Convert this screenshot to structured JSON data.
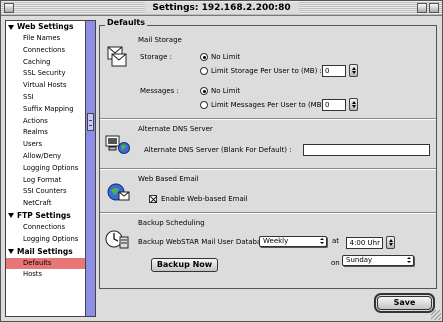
{
  "window": {
    "title": "Settings: 192.168.2.200:80"
  },
  "sidebar": {
    "groups": [
      {
        "label": "Web Settings",
        "items": [
          "File Names",
          "Connections",
          "Caching",
          "SSL Security",
          "Virtual Hosts",
          "SSI",
          "Suffix Mapping",
          "Actions",
          "Realms",
          "Users",
          "Allow/Deny",
          "Logging Options",
          "Log Format",
          "SSI Counters",
          "NetCraft"
        ]
      },
      {
        "label": "FTP Settings",
        "items": [
          "Connections",
          "Logging Options"
        ]
      },
      {
        "label": "Mail Settings",
        "items": [
          "Defaults",
          "Hosts"
        ]
      }
    ],
    "selected": "Defaults"
  },
  "main": {
    "group_title": "Defaults",
    "mail_storage": {
      "title": "Mail Storage",
      "storage_label": "Storage :",
      "storage_opt1": "No Limit",
      "storage_opt2": "Limit Storage Per User to (MB) :",
      "storage_value": "0",
      "messages_label": "Messages :",
      "messages_opt1": "No Limit",
      "messages_opt2": "Limit Messages Per User to (MB) :",
      "messages_value": "0"
    },
    "dns": {
      "title": "Alternate DNS Server",
      "field_label": "Alternate DNS Server (Blank For Default) :",
      "value": ""
    },
    "web_email": {
      "title": "Web Based Email",
      "checkbox_label": "Enable Web-based Email",
      "checked": true
    },
    "backup": {
      "title": "Backup Scheduling",
      "label": "Backup WebSTAR Mail User Database",
      "frequency": "Weekly",
      "at_label": "at",
      "time": "4:00 Uhr",
      "on_label": "on",
      "day": "Sunday",
      "button_label": "Backup Now"
    }
  },
  "footer": {
    "save_label": "Save"
  }
}
